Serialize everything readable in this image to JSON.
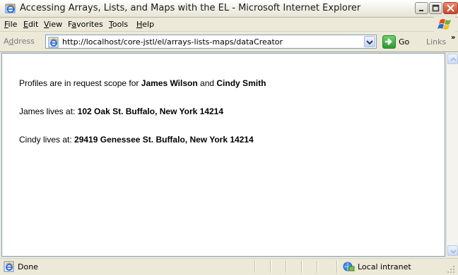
{
  "window": {
    "title": "Accessing Arrays, Lists, and Maps with the EL - Microsoft Internet Explorer"
  },
  "menu": {
    "items": [
      {
        "label": "File",
        "accel": "F",
        "rest": "ile"
      },
      {
        "label": "Edit",
        "accel": "E",
        "rest": "dit"
      },
      {
        "label": "View",
        "accel": "V",
        "rest": "iew"
      },
      {
        "label": "Favorites",
        "pre": "F",
        "accel": "a",
        "rest": "vorites"
      },
      {
        "label": "Tools",
        "accel": "T",
        "rest": "ools"
      },
      {
        "label": "Help",
        "accel": "H",
        "rest": "elp"
      }
    ]
  },
  "address": {
    "label_pre": "A",
    "label_accel": "d",
    "label_rest": "dress",
    "url": "http://localhost/core-jstl/el/arrays-lists-maps/dataCreator",
    "go_label": "Go",
    "links_label": "Links",
    "links_chevron": "»"
  },
  "content": {
    "line1_prefix": "Profiles are in request scope for ",
    "line1_name1": "James Wilson",
    "line1_and": " and ",
    "line1_name2": "Cindy Smith",
    "line2_prefix": "James lives at: ",
    "line2_address": "102 Oak St. Buffalo, New York 14214",
    "line3_prefix": "Cindy lives at: ",
    "line3_address": "29419 Genessee St. Buffalo, New York 14214"
  },
  "status": {
    "text": "Done",
    "zone": "Local intranet"
  },
  "icons": {
    "app": "ie-logo-icon",
    "page": "ie-page-icon",
    "go": "go-arrow-icon",
    "zone": "local-intranet-icon",
    "windows_logo": "windows-flag-icon"
  }
}
